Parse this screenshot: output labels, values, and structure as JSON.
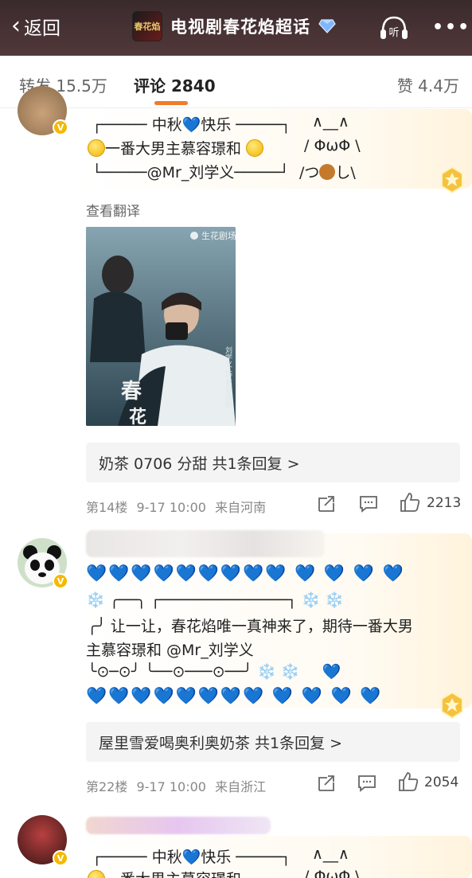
{
  "header": {
    "back_label": "返回",
    "title": "电视剧春花焰超话",
    "app_logo_text": "春花焰"
  },
  "tabs": {
    "repost": "转发 15.5万",
    "comment": "评论 2840",
    "like": "赞 4.4万"
  },
  "comment1": {
    "line1_left": "中秋",
    "line1_right": "快乐",
    "line2": "一番大男主慕容璟和",
    "line3": "@Mr_刘学义",
    "kaomoji_1": "∧__∧",
    "kaomoji_2": "/ ΦωΦ \\",
    "kaomoji_3": "/つ",
    "kaomoji_3b": "し\\",
    "translate": "查看翻译",
    "poster_brand": "生花剧场",
    "poster_title": "春花",
    "poster_side": "刘学义 饰 慕容璟和",
    "reply": "奶茶 0706 分甜  共1条回复 >",
    "floor": "第14楼",
    "time": "9-17 10:00",
    "location": "来自河南",
    "likes": "2213"
  },
  "comment2": {
    "text_line1": "让一让，春花焰唯一真神来了，期待一番大男",
    "text_line2": "主慕容璟和 @Mr_刘学义",
    "reply": "屋里雪爱喝奥利奥奶茶  共1条回复 >",
    "floor": "第22楼",
    "time": "9-17 10:00",
    "location": "来自浙江",
    "likes": "2054"
  },
  "comment3": {
    "line1_left": "中秋",
    "line1_right": "快乐",
    "line2": "一番大男主慕容璟和",
    "kaomoji_1": "∧__∧",
    "kaomoji_2": "/ ΦωΦ \\"
  },
  "colors": {
    "header_bg": "#3a2a2c",
    "accent": "#f07c2a",
    "heart": "#1f6fe0",
    "vip_gold": "#f5b800"
  }
}
